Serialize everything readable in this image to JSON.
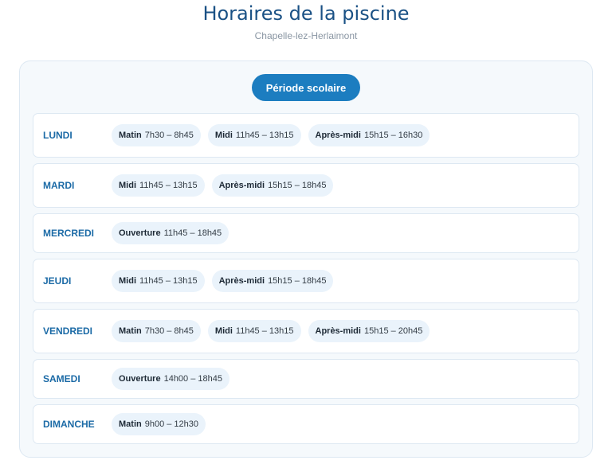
{
  "page": {
    "title": "Horaires de la piscine",
    "subtitle": "Chapelle-lez-Herlaimont",
    "period_button": "Période scolaire"
  },
  "colors": {
    "accent": "#1c7dc0",
    "day_label": "#1b6aa6",
    "title": "#1a5185",
    "chip_bg": "#eaf3fb"
  },
  "days": [
    {
      "name": "LUNDI",
      "slots": [
        {
          "label": "Matin",
          "time": "7h30 – 8h45"
        },
        {
          "label": "Midi",
          "time": "11h45 – 13h15"
        },
        {
          "label": "Après-midi",
          "time": "15h15 – 16h30"
        }
      ]
    },
    {
      "name": "MARDI",
      "slots": [
        {
          "label": "Midi",
          "time": "11h45 – 13h15"
        },
        {
          "label": "Après-midi",
          "time": "15h15 – 18h45"
        }
      ]
    },
    {
      "name": "MERCREDI",
      "slots": [
        {
          "label": "Ouverture",
          "time": "11h45 – 18h45"
        }
      ]
    },
    {
      "name": "JEUDI",
      "slots": [
        {
          "label": "Midi",
          "time": "11h45 – 13h15"
        },
        {
          "label": "Après-midi",
          "time": "15h15 – 18h45"
        }
      ]
    },
    {
      "name": "VENDREDI",
      "slots": [
        {
          "label": "Matin",
          "time": "7h30 – 8h45"
        },
        {
          "label": "Midi",
          "time": "11h45 – 13h15"
        },
        {
          "label": "Après-midi",
          "time": "15h15 – 20h45"
        }
      ]
    },
    {
      "name": "SAMEDI",
      "slots": [
        {
          "label": "Ouverture",
          "time": "14h00 – 18h45"
        }
      ]
    },
    {
      "name": "DIMANCHE",
      "slots": [
        {
          "label": "Matin",
          "time": "9h00 – 12h30"
        }
      ]
    }
  ]
}
